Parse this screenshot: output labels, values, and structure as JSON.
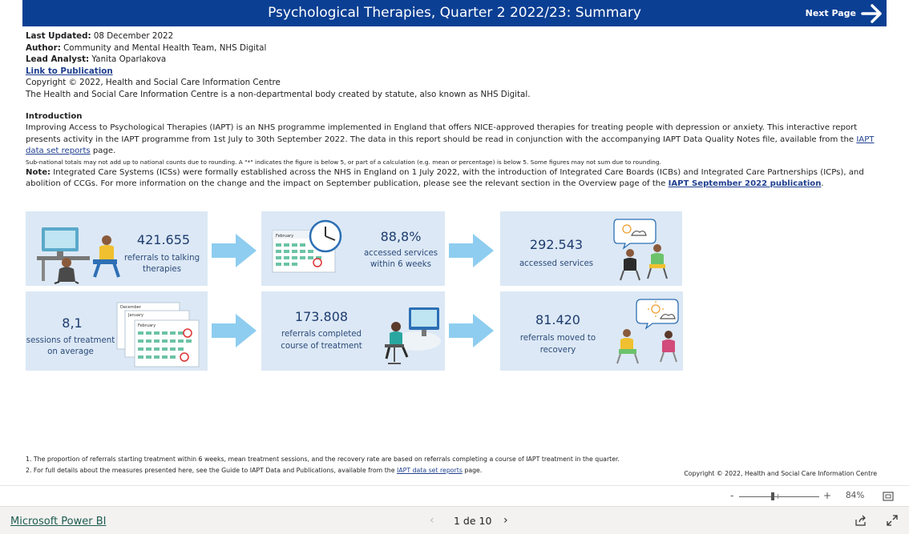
{
  "header": {
    "title": "Psychological Therapies, Quarter 2 2022/23: Summary",
    "next_page_label": "Next Page",
    "background": "#0b3f93"
  },
  "meta": {
    "last_updated_label": "Last Updated:",
    "last_updated_value": "08 December 2022",
    "author_label": "Author:",
    "author_value": "Community and Mental Health Team, NHS Digital",
    "lead_analyst_label": "Lead Analyst:",
    "lead_analyst_value": "Yanita Oparlakova",
    "publication_link": "Link to Publication",
    "copyright": "Copyright © 2022, Health and Social Care Information Centre",
    "body_statement": "The Health and Social Care Information Centre is a non-departmental body created by statute, also known as NHS Digital."
  },
  "intro": {
    "heading": "Introduction",
    "paragraph_start": "Improving Access to Psychological Therapies (IAPT) is an NHS programme implemented in England that offers NICE-approved therapies for treating people with depression or anxiety. This interactive report presents activity in the IAPT programme from 1st July to 30th September 2022. The data in this report should be read in conjunction with the accompanying IAPT Data Quality Notes file, available from the ",
    "data_set_link": "IAPT data set reports",
    "paragraph_end": " page.",
    "rounding_note": "Sub-national totals may not add up to national counts due to rounding. A \"*\" indicates the figure is below 5, or part of a calculation (e.g. mean or percentage) is below 5. Some figures may not sum due to rounding.",
    "note_label": "Note:",
    "note_text": " Integrated Care Systems (ICSs) were formally established across the NHS in England on 1 July 2022, with the introduction of Integrated Care Boards (ICBs) and Integrated Care Partnerships (ICPs), and abolition of CCGs. For more information on the change and the impact on September publication, please see the relevant section in the Overview page of the ",
    "note_link": "IAPT September 2022 publication",
    "note_end": "."
  },
  "cards": {
    "referrals": {
      "value": "421.655",
      "label_1": "referrals to talking",
      "label_2": "therapies"
    },
    "within_6_weeks": {
      "value": "88,8%",
      "label_1": "accessed services",
      "label_2": "within 6 weeks",
      "calendar_month": "February"
    },
    "accessed": {
      "value": "292.543",
      "label_1": "accessed services"
    },
    "sessions": {
      "value": "8,1",
      "label_1": "sessions of treatment",
      "label_2": "on average",
      "cal_1": "December",
      "cal_2": "January",
      "cal_3": "February"
    },
    "completed": {
      "value": "173.808",
      "label_1": "referrals completed",
      "label_2": "course of treatment"
    },
    "recovery": {
      "value": "81.420",
      "label_1": "referrals moved to",
      "label_2": "recovery"
    }
  },
  "colors": {
    "card_bg": "#dce8f5",
    "arrow": "#8ecdf0",
    "number": "#1d3c6e"
  },
  "footnotes": {
    "note_1": "1. The proportion of referrals starting treatment within 6 weeks, mean treatment sessions, and the recovery rate are based on referrals completing a course of IAPT treatment in the quarter.",
    "note_2_start": "2. For full details about the measures presented here, see the Guide to IAPT Data and Publications, available from the ",
    "note_2_link": "IAPT data set reports",
    "note_2_end": " page.",
    "copyright": "Copyright © 2022, Health and Social Care Information Centre"
  },
  "zoom": {
    "minus": "-",
    "plus": "+",
    "level": "84%"
  },
  "bottom": {
    "powerbi_link": "Microsoft Power BI",
    "page_indicator": "1 de 10",
    "prev_glyph": "‹",
    "next_glyph": "›"
  }
}
